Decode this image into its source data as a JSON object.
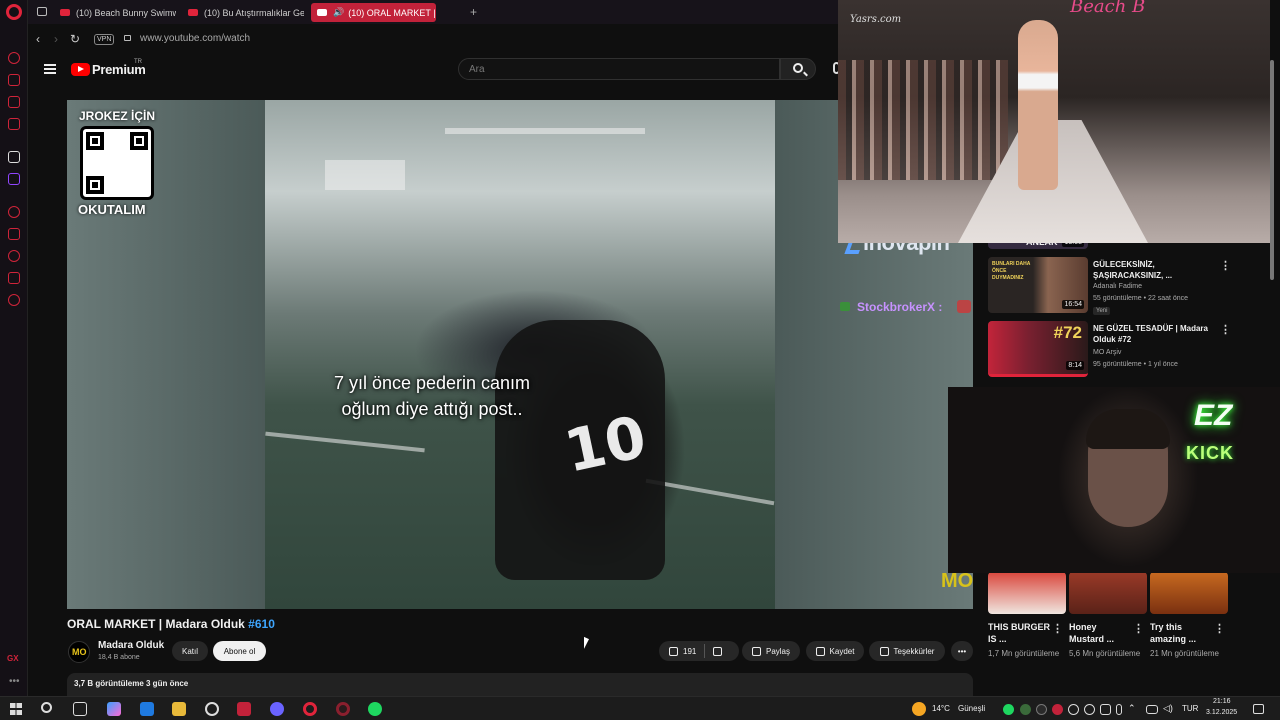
{
  "browser": {
    "tabs": [
      {
        "label": "(10) Beach Bunny Swimw"
      },
      {
        "label": "(10) Bu Atıştırmalıklar Ger"
      },
      {
        "label": "(10) ORAL MARKET |"
      }
    ],
    "vpn_label": "VPN",
    "url": "www.youtube.com/watch",
    "sidebar_badge": "GX"
  },
  "youtube": {
    "brand": "Premium",
    "brand_region": "TR",
    "search_placeholder": "Ara"
  },
  "video": {
    "overlay_top_label": "JROKEZ İÇİN",
    "overlay_bottom_label": "OKUTALIM",
    "caption_line1": "7 yıl önce pederin canım",
    "caption_line2": "oğlum diye attığı post..",
    "jersey_number": "10",
    "sponsor": "inovapin",
    "chat_user": "StockbrokerX :",
    "channel_badge": "MO"
  },
  "info": {
    "title": "ORAL MARKET | Madara Olduk",
    "title_hashtag": "#610",
    "channel_name": "Madara Olduk",
    "channel_subs": "18,4 B abone",
    "channel_avatar_text": "MO",
    "join_label": "Katıl",
    "subscribe_label": "Abone ol",
    "likes": "191",
    "share_label": "Paylaş",
    "save_label": "Kaydet",
    "thanks_label": "Teşekkürler",
    "views_date": "3,7 B görüntüleme  3 gün önce"
  },
  "recommendations": [
    {
      "title": "GÜLECEKSİNİZ, ŞAŞIRACAKSINIZ, ...",
      "channel": "Adanalı Fadime",
      "meta": "55 görüntüleme • 22 saat önce",
      "badge": "Yeni",
      "duration": "16:54",
      "thumb_text": "BUNLARI DAHA ÖNCE DUYMADINIZ"
    },
    {
      "title": "NE GÜZEL TESADÜF | Madara Olduk #72",
      "channel": "MO Arşiv",
      "meta": "95 görüntüleme • 1 yıl önce",
      "duration": "8:14",
      "thumb_text": "#72"
    }
  ],
  "partial_rec": {
    "title_fragment": "ANLAK",
    "duration": "13:08"
  },
  "shorts": [
    {
      "title": "THIS BURGER IS ...",
      "views": "1,7 Mn görüntüleme",
      "color": "#c4473a"
    },
    {
      "title": "Honey Mustard ...",
      "views": "5,6 Mn görüntüleme",
      "color": "#8a3a2a"
    },
    {
      "title": "Try this amazing ...",
      "views": "21 Mn görüntüleme",
      "color": "#b65a1c"
    }
  ],
  "overlays": {
    "fashion_watermark": "Yasrs.com",
    "fashion_brand": "Beach B",
    "stream_brand_top": "EZ",
    "stream_brand_bottom": "KICK"
  },
  "taskbar": {
    "weather": "14°C",
    "weather_desc": "Güneşli",
    "lang": "TUR",
    "time": "21:16",
    "date": "3.12.2025"
  },
  "colors": {
    "accent_red": "#e0243b",
    "youtube_red": "#ff0000",
    "link_blue": "#3ea6ff",
    "kick_green": "#3bff3b"
  }
}
